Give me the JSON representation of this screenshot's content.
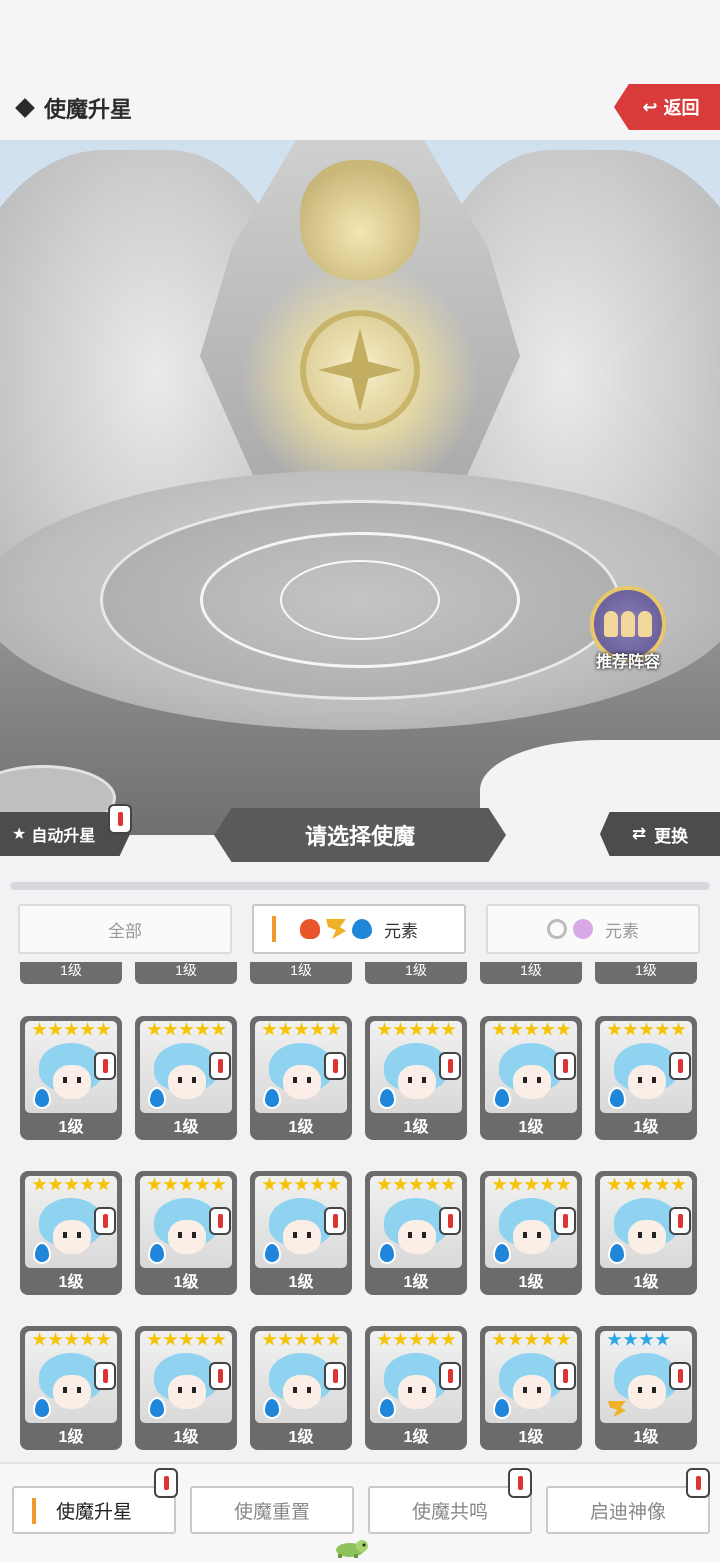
{
  "header": {
    "title": "使魔升星",
    "back_label": "返回"
  },
  "scene": {
    "recommend_label": "推荐阵容"
  },
  "controls": {
    "auto_label": "自动升星",
    "select_title": "请选择使魔",
    "swap_label": "更换"
  },
  "filters": [
    {
      "label": "全部",
      "active": false
    },
    {
      "label": "元素",
      "active": true,
      "icons": [
        "fire-icon",
        "wind-icon",
        "water-icon"
      ]
    },
    {
      "label": "元素",
      "active": false,
      "icons": [
        "light-icon",
        "dark-icon"
      ]
    }
  ],
  "partial_row": [
    "1级",
    "1级",
    "1级",
    "1级",
    "1级",
    "1级"
  ],
  "cards": [
    {
      "level": "1级",
      "stars": 5,
      "star_color": "gold",
      "element": "water"
    },
    {
      "level": "1级",
      "stars": 5,
      "star_color": "gold",
      "element": "water"
    },
    {
      "level": "1级",
      "stars": 5,
      "star_color": "gold",
      "element": "water"
    },
    {
      "level": "1级",
      "stars": 5,
      "star_color": "gold",
      "element": "water"
    },
    {
      "level": "1级",
      "stars": 5,
      "star_color": "gold",
      "element": "water"
    },
    {
      "level": "1级",
      "stars": 5,
      "star_color": "gold",
      "element": "water"
    },
    {
      "level": "1级",
      "stars": 5,
      "star_color": "gold",
      "element": "water"
    },
    {
      "level": "1级",
      "stars": 5,
      "star_color": "gold",
      "element": "water"
    },
    {
      "level": "1级",
      "stars": 5,
      "star_color": "gold",
      "element": "water"
    },
    {
      "level": "1级",
      "stars": 5,
      "star_color": "gold",
      "element": "water"
    },
    {
      "level": "1级",
      "stars": 5,
      "star_color": "gold",
      "element": "water"
    },
    {
      "level": "1级",
      "stars": 5,
      "star_color": "gold",
      "element": "water"
    },
    {
      "level": "1级",
      "stars": 5,
      "star_color": "gold",
      "element": "water"
    },
    {
      "level": "1级",
      "stars": 5,
      "star_color": "gold",
      "element": "water"
    },
    {
      "level": "1级",
      "stars": 5,
      "star_color": "gold",
      "element": "water"
    },
    {
      "level": "1级",
      "stars": 5,
      "star_color": "gold",
      "element": "water"
    },
    {
      "level": "1级",
      "stars": 5,
      "star_color": "gold",
      "element": "water"
    },
    {
      "level": "1级",
      "stars": 4,
      "star_color": "blue",
      "element": "wind"
    }
  ],
  "tabs": [
    {
      "label": "使魔升星",
      "active": true
    },
    {
      "label": "使魔重置",
      "active": false
    },
    {
      "label": "使魔共鸣",
      "active": false
    },
    {
      "label": "启迪神像",
      "active": false
    }
  ],
  "colors": {
    "accent": "#f39a2d",
    "back_red": "#d93a3a",
    "banner": "#5a5a5a",
    "star_gold": "#f5c400",
    "star_blue": "#2aa7e8",
    "water": "#1f86d9"
  }
}
